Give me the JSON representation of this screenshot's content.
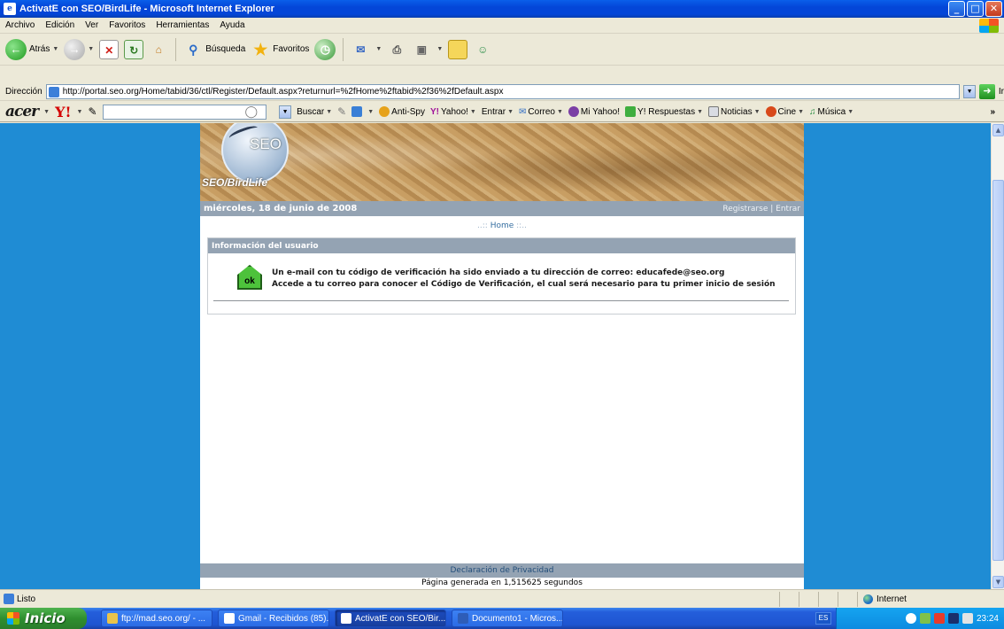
{
  "window": {
    "title": "ActivatE con SEO/BirdLife - Microsoft Internet Explorer"
  },
  "menu": [
    "Archivo",
    "Edición",
    "Ver",
    "Favoritos",
    "Herramientas",
    "Ayuda"
  ],
  "toolbar": {
    "back_label": "Atrás",
    "search_label": "Búsqueda",
    "favorites_label": "Favoritos"
  },
  "address": {
    "label": "Dirección",
    "url": "http://portal.seo.org/Home/tabid/36/ctl/Register/Default.aspx?returnurl=%2fHome%2ftabid%2f36%2fDefault.aspx",
    "go_label": "Ir"
  },
  "yahoo_toolbar": {
    "brand": "acer",
    "yahoo_logo": "Y!",
    "buscar": "Buscar",
    "antispy": "Anti-Spy",
    "yahoo": "Yahoo!",
    "entrar": "Entrar",
    "correo": "Correo",
    "mi_yahoo": "Mi Yahoo!",
    "respuestas": "Y! Respuestas",
    "noticias": "Noticias",
    "cine": "Cine",
    "musica": "Música",
    "more": "»"
  },
  "page": {
    "logo_seo": "SEO",
    "logo_caption": "SEO/BirdLife",
    "date": "miércoles, 18 de junio de 2008",
    "register": "Registrarse",
    "separator": "|",
    "login": "Entrar",
    "home_prefix": "..:: ",
    "home": "Home",
    "home_suffix": " ::..",
    "info_header": "Información del usuario",
    "ok_label": "ok",
    "message_line1": "Un e-mail con tu código de verificación ha sido enviado a tu dirección de correo: educafede@seo.org",
    "message_line2": "Accede a tu correo para conocer el Código de Verificación, el cual será necesario para tu primer inicio de sesión",
    "privacy": "Declaración de Privacidad",
    "generated": "Página generada en 1,515625 segundos"
  },
  "status": {
    "text": "Listo",
    "zone": "Internet"
  },
  "taskbar": {
    "start": "Inicio",
    "tasks": [
      "ftp://mad.seo.org/ - ...",
      "Gmail - Recibidos (85)...",
      "ActivatE con SEO/Bir...",
      "Documento1 - Micros..."
    ],
    "lang": "ES",
    "clock": "23:24"
  }
}
